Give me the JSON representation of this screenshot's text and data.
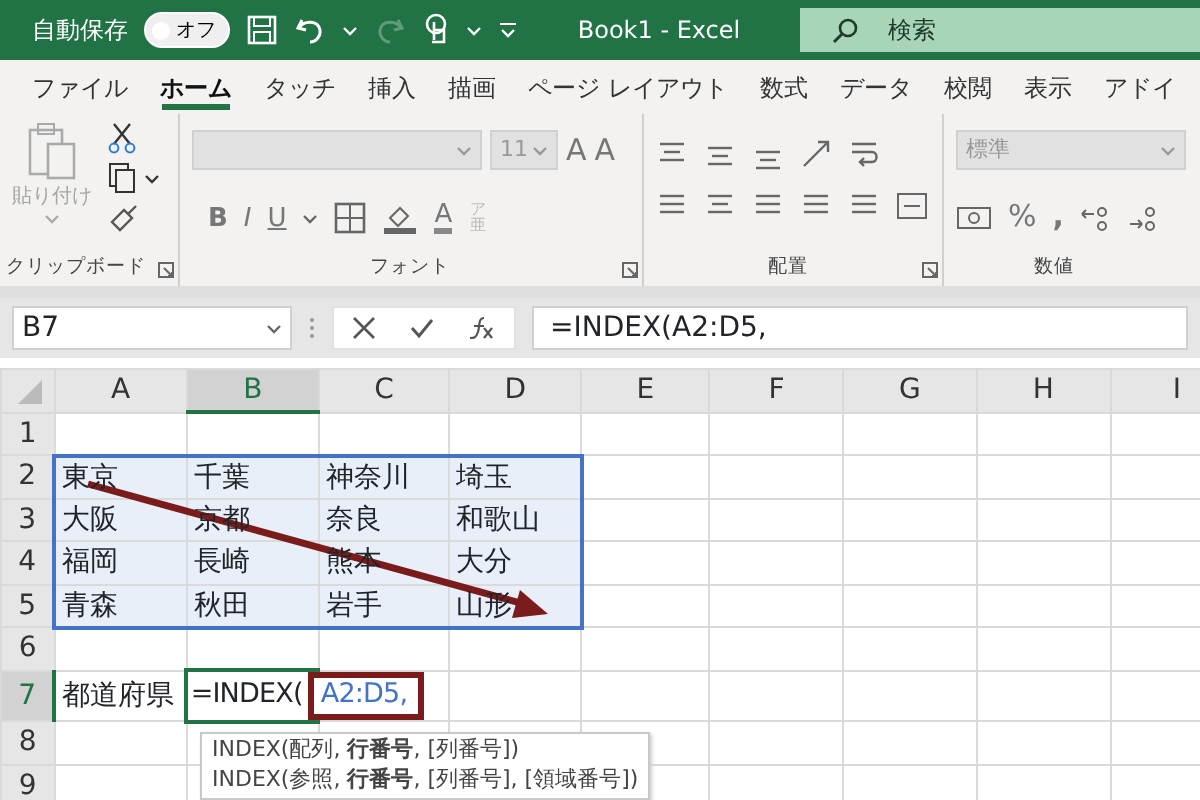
{
  "title_bar": {
    "autosave_label": "自動保存",
    "autosave_toggle": {
      "label": "オフ",
      "on": false
    },
    "redo_disabled": true,
    "title": "Book1 - Excel",
    "search": {
      "placeholder": "検索"
    }
  },
  "ribbon_tabs": [
    {
      "label": "ファイル",
      "selected": false
    },
    {
      "label": "ホーム",
      "selected": true
    },
    {
      "label": "タッチ",
      "selected": false
    },
    {
      "label": "挿入",
      "selected": false
    },
    {
      "label": "描画",
      "selected": false
    },
    {
      "label": "ページ レイアウト",
      "selected": false
    },
    {
      "label": "数式",
      "selected": false
    },
    {
      "label": "データ",
      "selected": false
    },
    {
      "label": "校閲",
      "selected": false
    },
    {
      "label": "表示",
      "selected": false
    },
    {
      "label": "アドイ",
      "selected": false
    }
  ],
  "ribbon": {
    "clipboard": {
      "paste_label": "貼り付け",
      "label": "クリップボード"
    },
    "font": {
      "font_size": "11",
      "grow_label": "A",
      "shrink_label": "A",
      "style_buttons": [
        "B",
        "I",
        "U"
      ],
      "font_color_label": "A",
      "phonetic_label": "ア亜",
      "label": "フォント"
    },
    "alignment": {
      "label": "配置"
    },
    "number": {
      "format": "標準",
      "percent_label": "%",
      "comma_label": ",",
      "label": "数値"
    }
  },
  "formula_bar": {
    "name_box": "B7",
    "formula": "=INDEX(A2:D5,"
  },
  "sheet": {
    "columns": [
      {
        "label": "A",
        "selected": false
      },
      {
        "label": "B",
        "selected": true
      },
      {
        "label": "C",
        "selected": false
      },
      {
        "label": "D",
        "selected": false
      },
      {
        "label": "E",
        "selected": false
      },
      {
        "label": "F",
        "selected": false
      },
      {
        "label": "G",
        "selected": false
      },
      {
        "label": "H",
        "selected": false
      },
      {
        "label": "I",
        "selected": false
      }
    ],
    "rows": [
      {
        "number": "1",
        "selected": false
      },
      {
        "number": "2",
        "selected": false,
        "cells": [
          {
            "text": "東京",
            "in_range": true
          },
          {
            "text": "千葉",
            "in_range": true
          },
          {
            "text": "神奈川",
            "in_range": true
          },
          {
            "text": "埼玉",
            "in_range": true
          }
        ]
      },
      {
        "number": "3",
        "selected": false,
        "cells": [
          {
            "text": "大阪",
            "in_range": true
          },
          {
            "text": "京都",
            "in_range": true
          },
          {
            "text": "奈良",
            "in_range": true
          },
          {
            "text": "和歌山",
            "in_range": true
          }
        ]
      },
      {
        "number": "4",
        "selected": false,
        "cells": [
          {
            "text": "福岡",
            "in_range": true
          },
          {
            "text": "長崎",
            "in_range": true
          },
          {
            "text": "熊本",
            "in_range": true
          },
          {
            "text": "大分",
            "in_range": true
          }
        ]
      },
      {
        "number": "5",
        "selected": false,
        "cells": [
          {
            "text": "青森",
            "in_range": true
          },
          {
            "text": "秋田",
            "in_range": true
          },
          {
            "text": "岩手",
            "in_range": true
          },
          {
            "text": "山形",
            "in_range": true
          }
        ]
      },
      {
        "number": "6",
        "selected": false
      },
      {
        "number": "7",
        "selected": true,
        "cells": [
          {
            "text": "都道府県",
            "in_range": false
          }
        ],
        "editing": {
          "prefix": "=INDEX(",
          "reference": "A2:D5,",
          "highlighted": true
        }
      },
      {
        "number": "8",
        "selected": false
      },
      {
        "number": "9",
        "selected": false
      }
    ]
  },
  "tooltip": {
    "lines": [
      "INDEX(配列, **行番号**, [列番号])",
      "INDEX(参照, **行番号**, [列番号], [領域番号])"
    ]
  }
}
